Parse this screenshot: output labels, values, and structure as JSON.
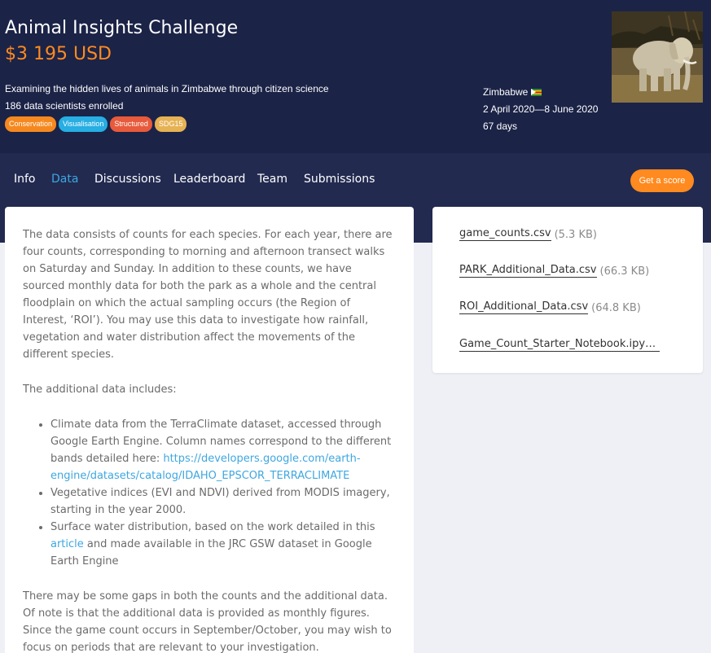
{
  "hero": {
    "title": "Animal Insights Challenge",
    "prize": "$3 195 USD",
    "description": "Examining the hidden lives of animals in Zimbabwe through citizen science",
    "enrolled": "186 data scientists enrolled",
    "tags": [
      {
        "label": "Conservation",
        "color": "#f5891f"
      },
      {
        "label": "Visualisation",
        "color": "#27aee3"
      },
      {
        "label": "Structured",
        "color": "#e85a3c"
      },
      {
        "label": "SDG15",
        "color": "#e6b254"
      }
    ],
    "country": "Zimbabwe",
    "dates": "2 April 2020—8 June 2020",
    "duration": "67 days"
  },
  "nav": {
    "tabs": [
      "Info",
      "Data",
      "Discussions",
      "Leaderboard",
      "Team",
      "Submissions"
    ],
    "active_tab": "Data",
    "score_button": "Get a score"
  },
  "content": {
    "para1": "The data consists of counts for each species. For each year, there are four counts, corresponding to morning and afternoon transect walks on Saturday and Sunday. In addition to these counts, we have sourced monthly data for both the park as a whole and the central floodplain on which the actual sampling occurs (the Region of Interest, ‘ROI’). You may use this data to investigate how rainfall, vegetation and water distribution affect the movements of the different species.",
    "para2": "The additional data includes:",
    "bullet1_text": "Climate data from the TerraClimate dataset, accessed through Google Earth Engine. Column names correspond to the different bands detailed here: ",
    "bullet1_link": "https://developers.google.com/earth-engine/datasets/catalog/IDAHO_EPSCOR_TERRACLIMATE",
    "bullet2": "Vegetative indices (EVI and NDVI) derived from MODIS imagery, starting in the year 2000.",
    "bullet3_pre": "Surface water distribution, based on the work detailed in this ",
    "bullet3_link": "article",
    "bullet3_post": " and made available in the JRC GSW dataset in Google Earth Engine",
    "para3": "There may be some gaps in both the counts and the additional data. Of note is that the additional data is provided as monthly figures. Since the game count occurs in September/October, you may wish to focus on periods that are relevant to your investigation."
  },
  "files": [
    {
      "name": "game_counts.csv",
      "size": "(5.3 KB)"
    },
    {
      "name": "PARK_Additional_Data.csv",
      "size": "(66.3 KB)"
    },
    {
      "name": "ROI_Additional_Data.csv",
      "size": "(64.8 KB)"
    },
    {
      "name": "Game_Count_Starter_Notebook.ipynb…",
      "size": ""
    }
  ]
}
